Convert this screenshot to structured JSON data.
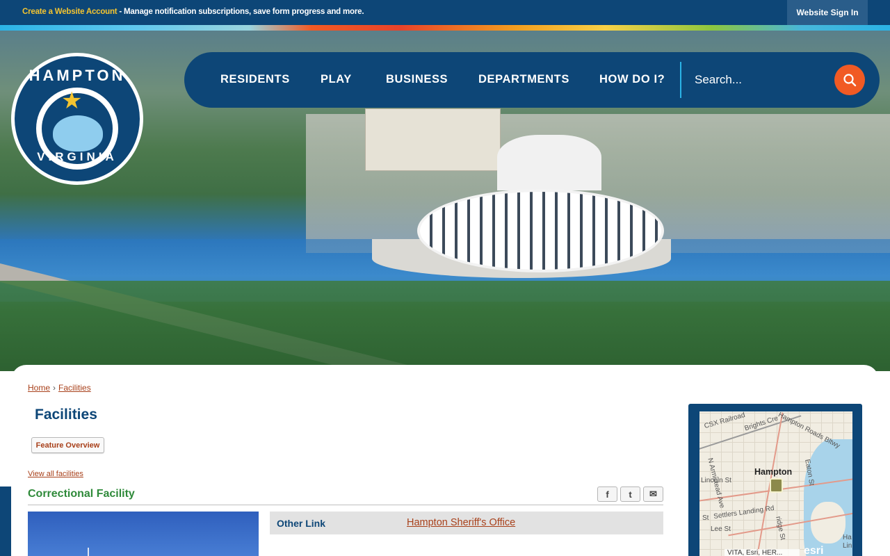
{
  "topbar": {
    "create_link": "Create a Website Account",
    "message": " - Manage notification subscriptions, save form progress and more.",
    "signin": "Website Sign In"
  },
  "logo": {
    "top_text": "HAMPTON",
    "bottom_text": "VIRGINIA"
  },
  "nav": {
    "items": [
      "RESIDENTS",
      "PLAY",
      "BUSINESS",
      "DEPARTMENTS",
      "HOW DO I?"
    ],
    "search_placeholder": "Search..."
  },
  "breadcrumb": {
    "home": "Home",
    "separator": "›",
    "current": "Facilities"
  },
  "page": {
    "title": "Facilities",
    "feature_button": "Feature Overview",
    "view_all": "View all facilities",
    "facility_name": "Correctional Facility"
  },
  "share": {
    "facebook": "f",
    "twitter": "t",
    "email": "✉"
  },
  "details": {
    "label": "Other Link",
    "value": "Hampton Sheriff's Office"
  },
  "map": {
    "city": "Hampton",
    "labels": [
      "CSX Railroad",
      "Brights Cre",
      "Hampton Roads Bltwy",
      "N Armistead Ave",
      "Eaton St",
      "Lincoln St",
      "Settlers Landing Rd",
      "Lee St",
      "St",
      "ridge St",
      "Ha",
      "Lin"
    ],
    "attribution": "VITA, Esri, HER...",
    "brand": "esri"
  },
  "colors": {
    "navy": "#0d4677",
    "accent_orange": "#f15a24",
    "link_rust": "#a8401a",
    "green_heading": "#2f8a3a",
    "gold": "#f4c430"
  }
}
